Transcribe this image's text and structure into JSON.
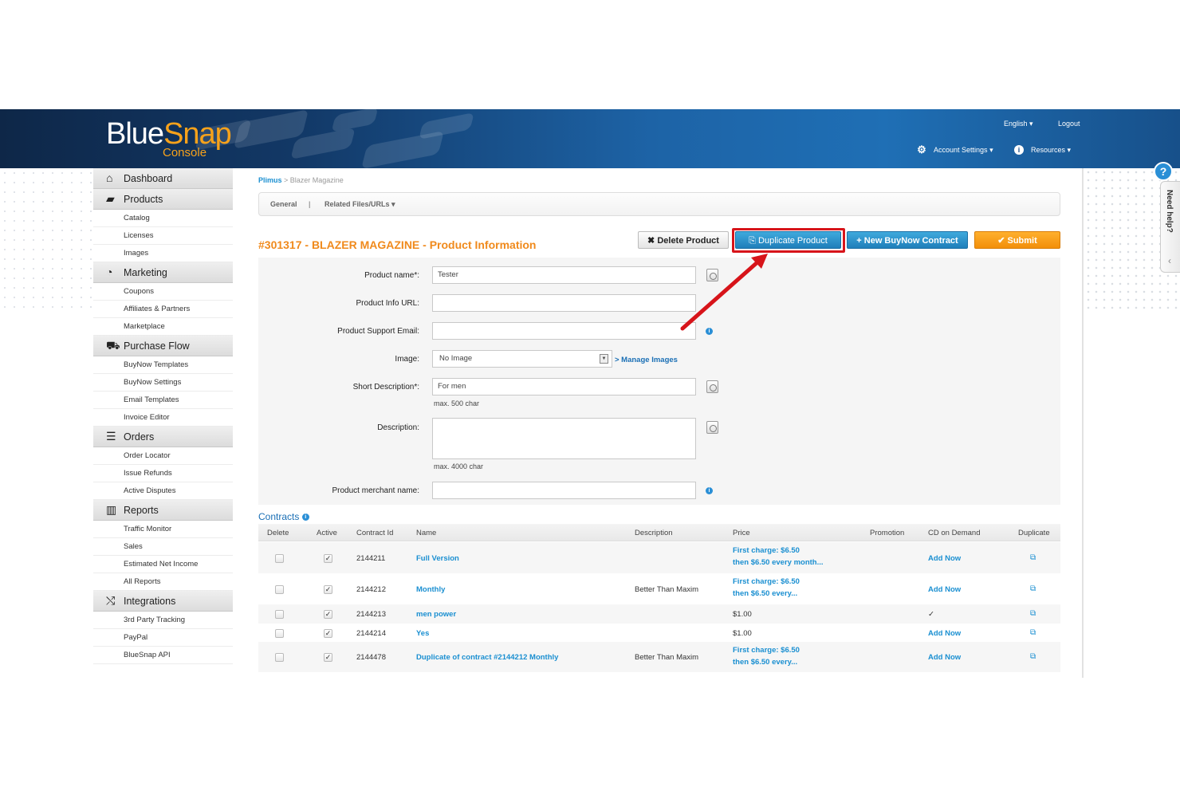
{
  "header": {
    "logo_blue": "Blue",
    "logo_snap": "Snap",
    "logo_sub": "Console",
    "language": "English",
    "logout": "Logout",
    "account_settings": "Account Settings",
    "resources": "Resources"
  },
  "sidebar": {
    "groups": [
      {
        "label": "Dashboard",
        "icon": "home-icon",
        "items": []
      },
      {
        "label": "Products",
        "icon": "folder-icon",
        "items": [
          "Catalog",
          "Licenses",
          "Images"
        ]
      },
      {
        "label": "Marketing",
        "icon": "dashboard-icon",
        "items": [
          "Coupons",
          "Affiliates & Partners",
          "Marketplace"
        ]
      },
      {
        "label": "Purchase Flow",
        "icon": "cart-icon",
        "items": [
          "BuyNow Templates",
          "BuyNow Settings",
          "Email Templates",
          "Invoice Editor"
        ]
      },
      {
        "label": "Orders",
        "icon": "list-icon",
        "items": [
          "Order Locator",
          "Issue Refunds",
          "Active Disputes"
        ]
      },
      {
        "label": "Reports",
        "icon": "chart-icon",
        "items": [
          "Traffic Monitor",
          "Sales",
          "Estimated Net Income",
          "All Reports"
        ]
      },
      {
        "label": "Integrations",
        "icon": "shuffle-icon",
        "items": [
          "3rd Party Tracking",
          "PayPal",
          "BlueSnap API"
        ]
      }
    ]
  },
  "breadcrumb": {
    "root": "Plimus",
    "sep": " > ",
    "current": "Blazer Magazine"
  },
  "tabs": {
    "general": "General",
    "sep": "|",
    "related": "Related Files/URLs ▾"
  },
  "page": {
    "title": "#301317 - BLAZER MAGAZINE - Product Information"
  },
  "buttons": {
    "delete": "✖ Delete Product",
    "duplicate": "⎘ Duplicate Product",
    "new_contract": "+ New BuyNow Contract",
    "submit": "✔ Submit"
  },
  "form": {
    "product_name_label": "Product name*:",
    "product_name_value": "Tester",
    "info_url_label": "Product Info URL:",
    "info_url_value": "",
    "support_email_label": "Product Support Email:",
    "support_email_value": "",
    "image_label": "Image:",
    "image_value": "No Image",
    "manage_images": "> Manage Images",
    "short_desc_label": "Short Description*:",
    "short_desc_value": "For men",
    "short_desc_hint": "max. 500 char",
    "desc_label": "Description:",
    "desc_value": "",
    "desc_hint": "max. 4000 char",
    "merchant_name_label": "Product merchant name:",
    "merchant_name_value": ""
  },
  "contracts": {
    "title": "Contracts",
    "columns": [
      "Delete",
      "Active",
      "Contract Id",
      "Name",
      "Description",
      "Price",
      "Promotion",
      "CD on Demand",
      "Duplicate"
    ],
    "rows": [
      {
        "id": "2144211",
        "name": "Full Version",
        "description": "",
        "price1": "First charge: $6.50",
        "price2": "then $6.50 every month...",
        "cd": "Add Now",
        "active": "✓"
      },
      {
        "id": "2144212",
        "name": "Monthly",
        "description": "Better Than Maxim",
        "price1": "First charge: $6.50",
        "price2": "then $6.50 every...",
        "cd": "Add Now",
        "active": "✓"
      },
      {
        "id": "2144213",
        "name": "men power",
        "description": "",
        "price1": "$1.00",
        "price2": "",
        "cd": "✓",
        "active": "✓"
      },
      {
        "id": "2144214",
        "name": "Yes",
        "description": "",
        "price1": "$1.00",
        "price2": "",
        "cd": "Add Now",
        "active": "✓"
      },
      {
        "id": "2144478",
        "name": "Duplicate of contract #2144212 Monthly",
        "description": "Better Than Maxim",
        "price1": "First charge: $6.50",
        "price2": "then $6.50 every...",
        "cd": "Add Now",
        "active": "✓"
      }
    ]
  },
  "help": {
    "need_help": "Need help?",
    "q": "?",
    "collapse": "‹"
  },
  "colors": {
    "accent_orange": "#f08a1c",
    "link_blue": "#1a8fd1",
    "highlight_red": "#d7141a"
  }
}
